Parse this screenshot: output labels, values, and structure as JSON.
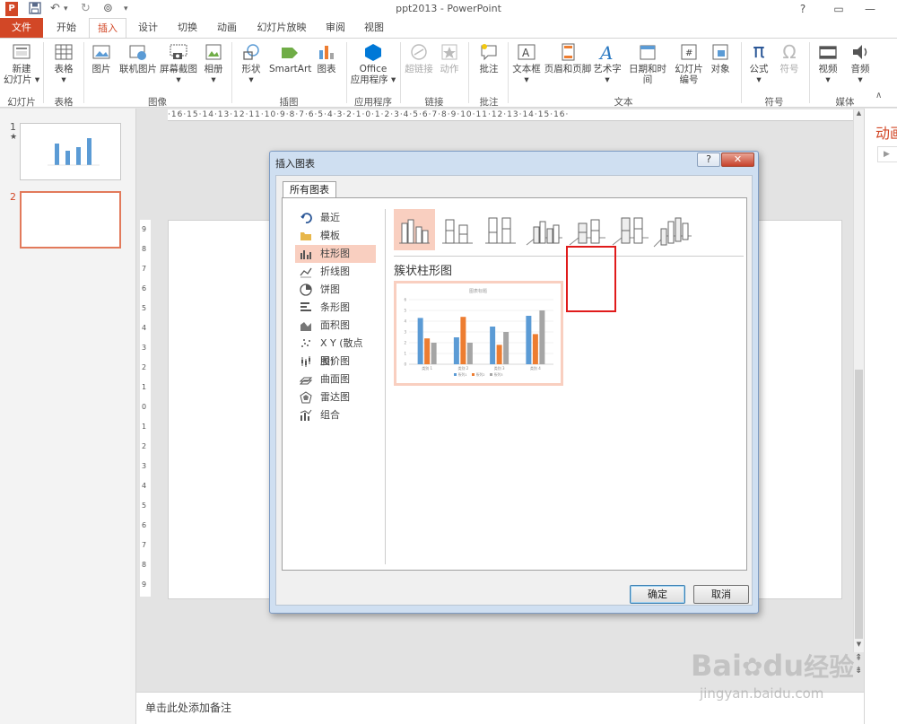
{
  "window": {
    "title": "ppt2013 - PowerPoint",
    "help": "?",
    "minimize": "—",
    "close": "✕"
  },
  "tabs": [
    {
      "label": "文件"
    },
    {
      "label": "开始"
    },
    {
      "label": "插入"
    },
    {
      "label": "设计"
    },
    {
      "label": "切换"
    },
    {
      "label": "动画"
    },
    {
      "label": "幻灯片放映"
    },
    {
      "label": "审阅"
    },
    {
      "label": "视图"
    }
  ],
  "ribbon": {
    "new_slide": "新建\n幻灯片 ▾",
    "table": "表格\n▾",
    "picture": "图片",
    "online_picture": "联机图片",
    "screenshot": "屏幕截图\n▾",
    "album": "相册\n▾",
    "shapes": "形状\n▾",
    "smartart": "SmartArt",
    "chart": "图表",
    "office_apps": "Office\n应用程序 ▾",
    "hyperlink": "超链接",
    "action": "动作",
    "comment": "批注",
    "textbox": "文本框\n▾",
    "header_footer": "页眉和页脚",
    "wordart": "艺术字\n▾",
    "datetime": "日期和时间",
    "slide_number": "幻灯片\n编号",
    "object": "对象",
    "equation": "公式\n▾",
    "symbol": "符号",
    "video": "视频\n▾",
    "audio": "音频\n▾",
    "groups": {
      "slides": "幻灯片",
      "tables": "表格",
      "images": "图像",
      "illustrations": "插图",
      "apps": "应用程序",
      "links": "链接",
      "comments": "批注",
      "text": "文本",
      "symbols": "符号",
      "media": "媒体"
    }
  },
  "ruler": {
    "horizontal": "·16·15·14·13·12·11·10·9·8·7·6·5·4·3·2·1·0·1·2·3·4·5·6·7·8·9·10·11·12·13·14·15·16·",
    "vertical": [
      "9",
      "8",
      "7",
      "6",
      "5",
      "4",
      "3",
      "2",
      "1",
      "0",
      "1",
      "2",
      "3",
      "4",
      "5",
      "6",
      "7",
      "8",
      "9"
    ]
  },
  "slides_panel": {
    "slide1_num": "1",
    "slide1_star": "★",
    "slide2_num": "2"
  },
  "notes": {
    "placeholder": "单击此处添加备注"
  },
  "right_pane": {
    "title": "动画",
    "arrow": "▶"
  },
  "dialog": {
    "title": "插入图表",
    "tab": "所有图表",
    "categories": [
      {
        "label": "最近",
        "icon": "recent-icon"
      },
      {
        "label": "模板",
        "icon": "folder-icon"
      },
      {
        "label": "柱形图",
        "icon": "column-chart-icon",
        "selected": true
      },
      {
        "label": "折线图",
        "icon": "line-chart-icon"
      },
      {
        "label": "饼图",
        "icon": "pie-chart-icon"
      },
      {
        "label": "条形图",
        "icon": "bar-chart-icon"
      },
      {
        "label": "面积图",
        "icon": "area-chart-icon"
      },
      {
        "label": "X Y (散点图)",
        "icon": "scatter-chart-icon"
      },
      {
        "label": "股价图",
        "icon": "stock-chart-icon"
      },
      {
        "label": "曲面图",
        "icon": "surface-chart-icon"
      },
      {
        "label": "雷达图",
        "icon": "radar-chart-icon"
      },
      {
        "label": "组合",
        "icon": "combo-chart-icon"
      }
    ],
    "selected_type_name": "簇状柱形图",
    "ok": "确定",
    "cancel": "取消",
    "preview_chart_title": "图表标题",
    "accent_selected": "#f9cfc0",
    "highlight_box_color": "#e01b1b"
  },
  "chart_data": {
    "type": "bar",
    "title": "图表标题",
    "categories": [
      "类别 1",
      "类别 2",
      "类别 3",
      "类别 4"
    ],
    "series": [
      {
        "name": "系列1",
        "values": [
          4.3,
          2.5,
          3.5,
          4.5
        ],
        "color": "#5b9bd5"
      },
      {
        "name": "系列2",
        "values": [
          2.4,
          4.4,
          1.8,
          2.8
        ],
        "color": "#ed7d31"
      },
      {
        "name": "系列3",
        "values": [
          2.0,
          2.0,
          3.0,
          5.0
        ],
        "color": "#a5a5a5"
      }
    ],
    "ylim": [
      0,
      6
    ],
    "yticks": [
      "6",
      "5",
      "4",
      "3",
      "2",
      "1",
      "0"
    ],
    "grid": true,
    "legend": "bottom"
  },
  "watermark": {
    "brand": "Bai",
    "brand2": "du",
    "brand_cn": "经验",
    "url": "jingyan.baidu.com"
  },
  "colors": {
    "file_tab": "#d24726",
    "active_tab_text": "#d24726"
  }
}
